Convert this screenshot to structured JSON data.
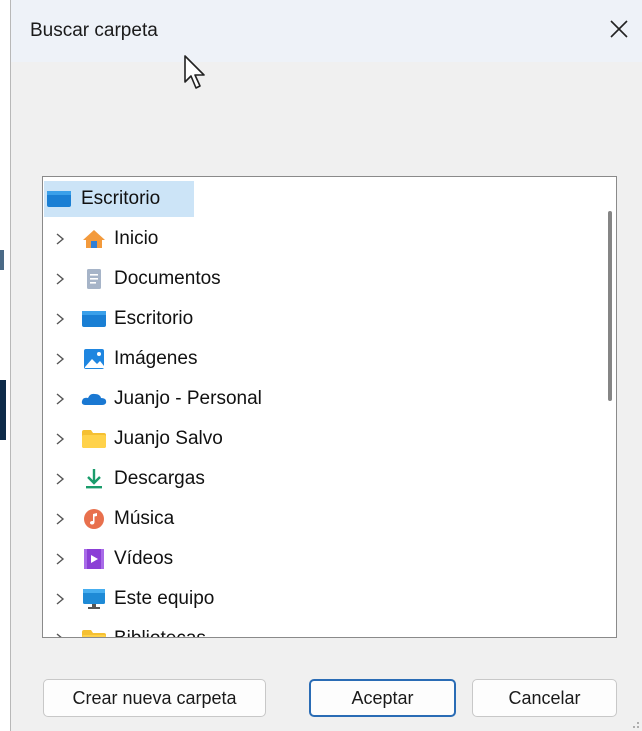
{
  "dialog": {
    "title": "Buscar carpeta",
    "close_icon": "close-icon"
  },
  "tree": {
    "root": {
      "label": "Escritorio",
      "icon": "desktop-folder-icon"
    },
    "items": [
      {
        "label": "Inicio",
        "icon": "home-icon"
      },
      {
        "label": "Documentos",
        "icon": "documents-icon"
      },
      {
        "label": "Escritorio",
        "icon": "desktop-folder-icon"
      },
      {
        "label": "Imágenes",
        "icon": "pictures-icon"
      },
      {
        "label": "Juanjo - Personal",
        "icon": "onedrive-cloud-icon"
      },
      {
        "label": "Juanjo Salvo",
        "icon": "user-folder-icon"
      },
      {
        "label": "Descargas",
        "icon": "downloads-icon"
      },
      {
        "label": "Música",
        "icon": "music-icon"
      },
      {
        "label": "Vídeos",
        "icon": "videos-icon"
      },
      {
        "label": "Este equipo",
        "icon": "computer-icon"
      },
      {
        "label": "Bibliotecas",
        "icon": "libraries-folder-icon"
      }
    ]
  },
  "buttons": {
    "new_folder": "Crear nueva carpeta",
    "ok": "Aceptar",
    "cancel": "Cancelar"
  },
  "colors": {
    "selection": "#cce4f7",
    "accent": "#2a6cb5",
    "titlebar": "#eef2f8"
  }
}
